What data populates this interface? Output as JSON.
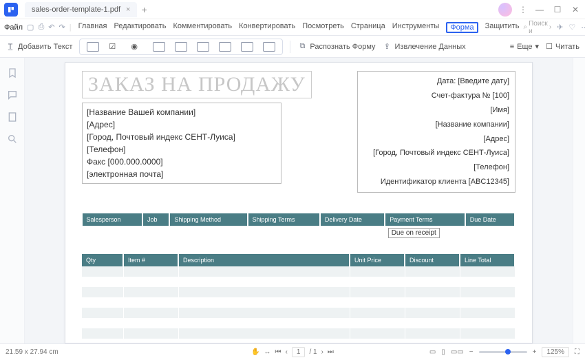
{
  "window": {
    "tab_title": "sales-order-template-1.pdf",
    "controls": {
      "min": "—",
      "max": "☐",
      "close": "✕",
      "dots": "⋮"
    }
  },
  "menu": {
    "file": "Файл",
    "items": [
      "Главная",
      "Редактировать",
      "Комментировать",
      "Конвертировать",
      "Посмотреть",
      "Страница",
      "Инструменты",
      "Форма",
      "Защитить"
    ],
    "active_index": 7,
    "search_placeholder": "Поиск и"
  },
  "toolbar": {
    "add_text": "Добавить Текст",
    "recognize": "Распознать Форму",
    "extract": "Извлечение Данных",
    "more": "Еще",
    "read": "Читать"
  },
  "document": {
    "title": "ЗАКАЗ НА ПРОДАЖУ",
    "company_lines": [
      "[Название Вашей компании]",
      "[Адрес]",
      "[Город, Почтовый индекс СЕНТ-Луиса]",
      "[Телефон]",
      "Факс [000.000.0000]",
      "[электронная почта]"
    ],
    "right_lines": [
      "Дата: [Введите дату]",
      "Счет-фактура № [100]",
      "[Имя]",
      "[Название компании]",
      "[Адрес]",
      "[Город, Почтовый индекс СЕНТ-Луиса]",
      "[Телефон]",
      "Идентификатор клиента [ABC12345]"
    ],
    "table1_headers": [
      "Salesperson",
      "Job",
      "Shipping Method",
      "Shipping Terms",
      "Delivery Date",
      "Payment Terms",
      "Due Date"
    ],
    "payment_term_value": "Due on receipt",
    "table2_headers": [
      "Qty",
      "Item #",
      "Description",
      "Unit Price",
      "Discount",
      "Line Total"
    ]
  },
  "status": {
    "dims": "21.59 x 27.94 cm",
    "page_current": "1",
    "page_total": "/ 1",
    "zoom": "125%"
  }
}
